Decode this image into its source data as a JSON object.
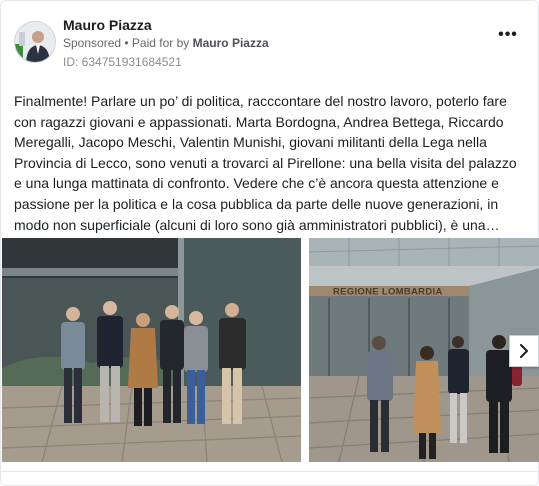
{
  "post": {
    "author": "Mauro Piazza",
    "sponsored": "Sponsored",
    "separator": " • ",
    "paid_prefix": "Paid for by ",
    "paid_by": "Mauro Piazza",
    "ad_id": "ID: 634751931684521",
    "more_label": "•••",
    "text": "Finalmente! Parlare un po’ di politica, racccontare del nostro lavoro, poterlo fare con ragazzi giovani e appassionati. Marta Bordogna, Andrea Bettega, Riccardo Meregalli, Jacopo Meschi, Valentin Munishi, giovani militanti della Lega nella Provincia di Lecco, sono venuti a trovarci al Pirellone: una bella visita del palazzo e una lunga mattinata di confronto. Vedere che c’è ancora questa attenzione e passione per la politica e la cosa pubblica da parte delle nuove generazioni, in modo non superficiale (alcuni di loro sono già amministratori pubblici), è una…"
  },
  "photos": {
    "building_sign": "REGIONE LOMBARDIA"
  },
  "icons": {
    "more": "more-dots-icon",
    "next": "chevron-right-icon"
  }
}
